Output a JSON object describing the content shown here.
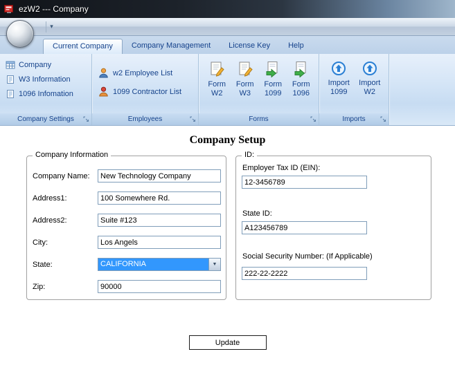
{
  "window": {
    "title": "ezW2 --- Company"
  },
  "tabs": {
    "items": [
      {
        "label": "Current Company"
      },
      {
        "label": "Company Management"
      },
      {
        "label": "License Key"
      },
      {
        "label": "Help"
      }
    ]
  },
  "ribbon": {
    "company_settings": {
      "caption": "Company Settings",
      "items": [
        {
          "label": "Company"
        },
        {
          "label": "W3 Information"
        },
        {
          "label": "1096 Infomation"
        }
      ]
    },
    "employees": {
      "caption": "Employees",
      "items": [
        {
          "label": "w2 Employee List"
        },
        {
          "label": "1099 Contractor List"
        }
      ]
    },
    "forms": {
      "caption": "Forms",
      "items": [
        {
          "line1": "Form",
          "line2": "W2"
        },
        {
          "line1": "Form",
          "line2": "W3"
        },
        {
          "line1": "Form",
          "line2": "1099"
        },
        {
          "line1": "Form",
          "line2": "1096"
        }
      ]
    },
    "imports": {
      "caption": "Imports",
      "items": [
        {
          "line1": "Import",
          "line2": "1099"
        },
        {
          "line1": "Import",
          "line2": "W2"
        }
      ]
    }
  },
  "main": {
    "title": "Company Setup",
    "company_info": {
      "legend": "Company Information",
      "company_name": {
        "label": "Company Name:",
        "value": "New Technology Company"
      },
      "address1": {
        "label": "Address1:",
        "value": "100 Somewhere Rd."
      },
      "address2": {
        "label": "Address2:",
        "value": "Suite #123"
      },
      "city": {
        "label": "City:",
        "value": "Los Angels"
      },
      "state": {
        "label": "State:",
        "value": "CALIFORNIA"
      },
      "zip": {
        "label": "Zip:",
        "value": "90000"
      }
    },
    "ids": {
      "legend": "ID:",
      "ein": {
        "label": "Employer Tax ID (EIN):",
        "value": "12-3456789"
      },
      "state_id": {
        "label": "State ID:",
        "value": "A123456789"
      },
      "ssn": {
        "label": "Social Security Number: (If Applicable)",
        "value": "222-22-2222"
      }
    },
    "update_label": "Update",
    "accent_color": "#15428b"
  }
}
